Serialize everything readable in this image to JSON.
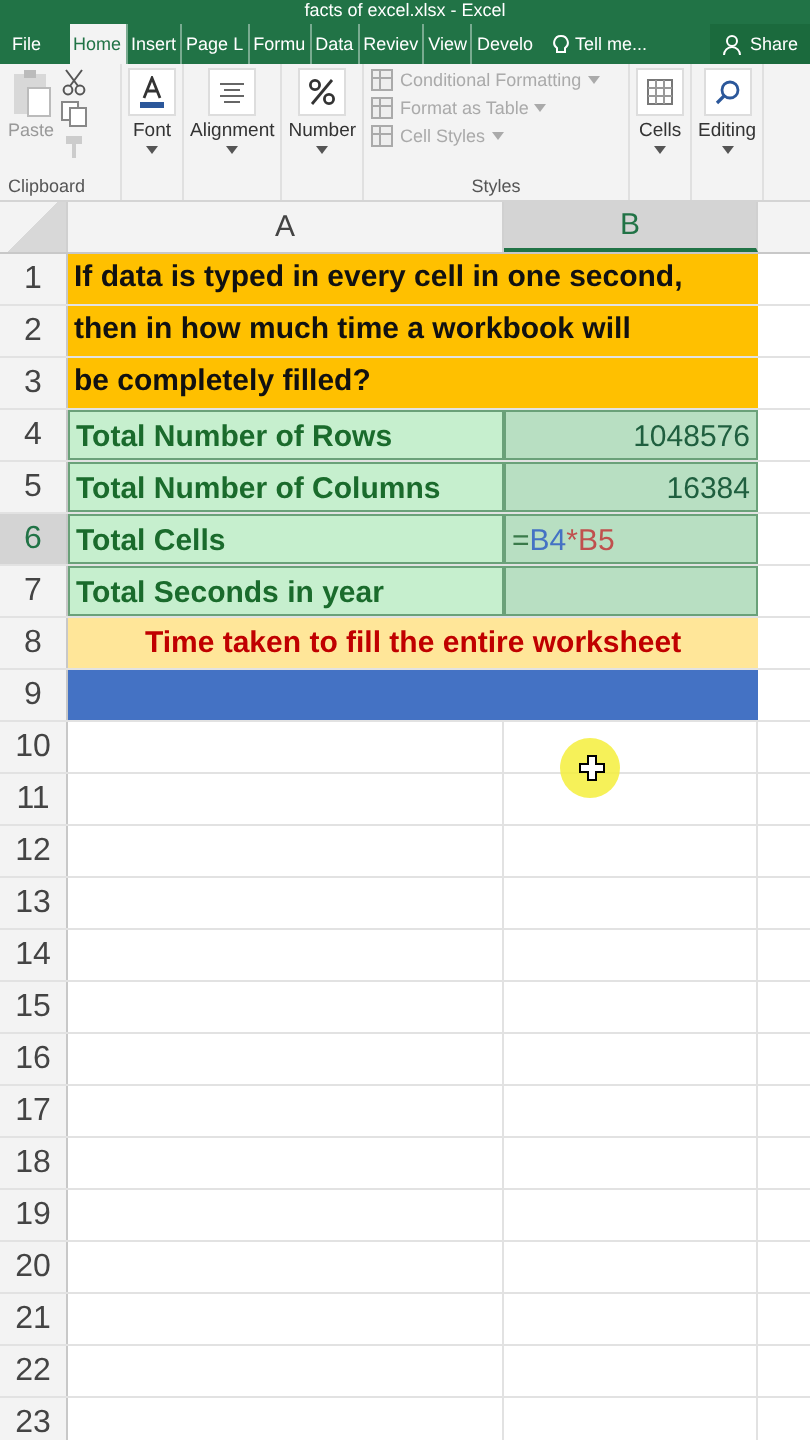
{
  "window": {
    "title": "facts of excel.xlsx - Excel"
  },
  "tabs": [
    {
      "label": "File",
      "selected": false
    },
    {
      "label": "Home",
      "selected": true
    },
    {
      "label": "Insert",
      "selected": false
    },
    {
      "label": "Page L",
      "selected": false
    },
    {
      "label": "Formu",
      "selected": false
    },
    {
      "label": "Data",
      "selected": false
    },
    {
      "label": "Reviev",
      "selected": false
    },
    {
      "label": "View",
      "selected": false
    },
    {
      "label": "Develo",
      "selected": false
    }
  ],
  "tell_me": "Tell me...",
  "share": "Share",
  "ribbon": {
    "clipboard": {
      "paste": "Paste",
      "label": "Clipboard"
    },
    "groups": [
      {
        "label": "Font",
        "kind": "font"
      },
      {
        "label": "Alignment",
        "kind": "align"
      },
      {
        "label": "Number",
        "kind": "number"
      }
    ],
    "styles": {
      "items": [
        {
          "label": "Conditional Formatting",
          "disabled": true
        },
        {
          "label": "Format as Table",
          "disabled": true
        },
        {
          "label": "Cell Styles",
          "disabled": true
        }
      ],
      "label": "Styles"
    },
    "tail": [
      {
        "label": "Cells",
        "kind": "cells"
      },
      {
        "label": "Editing",
        "kind": "editing"
      }
    ]
  },
  "columns": [
    {
      "label": "A",
      "selected": false
    },
    {
      "label": "B",
      "selected": true
    }
  ],
  "rows": [
    {
      "number": "1",
      "kind": "question",
      "text": "If data is typed in every cell in one second,",
      "selected": false
    },
    {
      "number": "2",
      "kind": "question",
      "text": "then in how much time a workbook will",
      "selected": false
    },
    {
      "number": "3",
      "kind": "question",
      "text": "be completely filled?",
      "selected": false
    },
    {
      "number": "4",
      "kind": "label",
      "a": "Total Number of Rows",
      "b": [
        {
          "text": "1048576",
          "color": "#1f5f3f"
        }
      ],
      "selected": false
    },
    {
      "number": "5",
      "kind": "label",
      "a": "Total Number of Columns",
      "b": [
        {
          "text": "16384",
          "color": "#1f5f3f"
        }
      ],
      "selected": false
    },
    {
      "number": "6",
      "kind": "label",
      "a": "Total Cells",
      "formula_parts": [
        {
          "text": "=",
          "color": "#3a7a4a"
        },
        {
          "text": "B4",
          "color": "#4472c4"
        },
        {
          "text": "*",
          "color": "#c0504d"
        },
        {
          "text": "B5",
          "color": "#c0504d"
        }
      ],
      "selected": true
    },
    {
      "number": "7",
      "kind": "label",
      "a": "Total Seconds in year",
      "b": [],
      "selected": false
    },
    {
      "number": "8",
      "kind": "banner",
      "text": "Time taken to fill the entire worksheet",
      "selected": false
    },
    {
      "number": "9",
      "kind": "bar",
      "selected": false
    },
    {
      "number": "10",
      "kind": "empty",
      "selected": false
    },
    {
      "number": "11",
      "kind": "empty",
      "selected": false
    },
    {
      "number": "12",
      "kind": "empty",
      "selected": false
    },
    {
      "number": "13",
      "kind": "empty",
      "selected": false
    },
    {
      "number": "14",
      "kind": "empty",
      "selected": false
    },
    {
      "number": "15",
      "kind": "empty",
      "selected": false
    },
    {
      "number": "16",
      "kind": "empty",
      "selected": false
    },
    {
      "number": "17",
      "kind": "empty",
      "selected": false
    },
    {
      "number": "18",
      "kind": "empty",
      "selected": false
    },
    {
      "number": "19",
      "kind": "empty",
      "selected": false
    },
    {
      "number": "20",
      "kind": "empty",
      "selected": false
    },
    {
      "number": "21",
      "kind": "empty",
      "selected": false
    },
    {
      "number": "22",
      "kind": "empty",
      "selected": false
    },
    {
      "number": "23",
      "kind": "empty",
      "selected": false
    }
  ]
}
